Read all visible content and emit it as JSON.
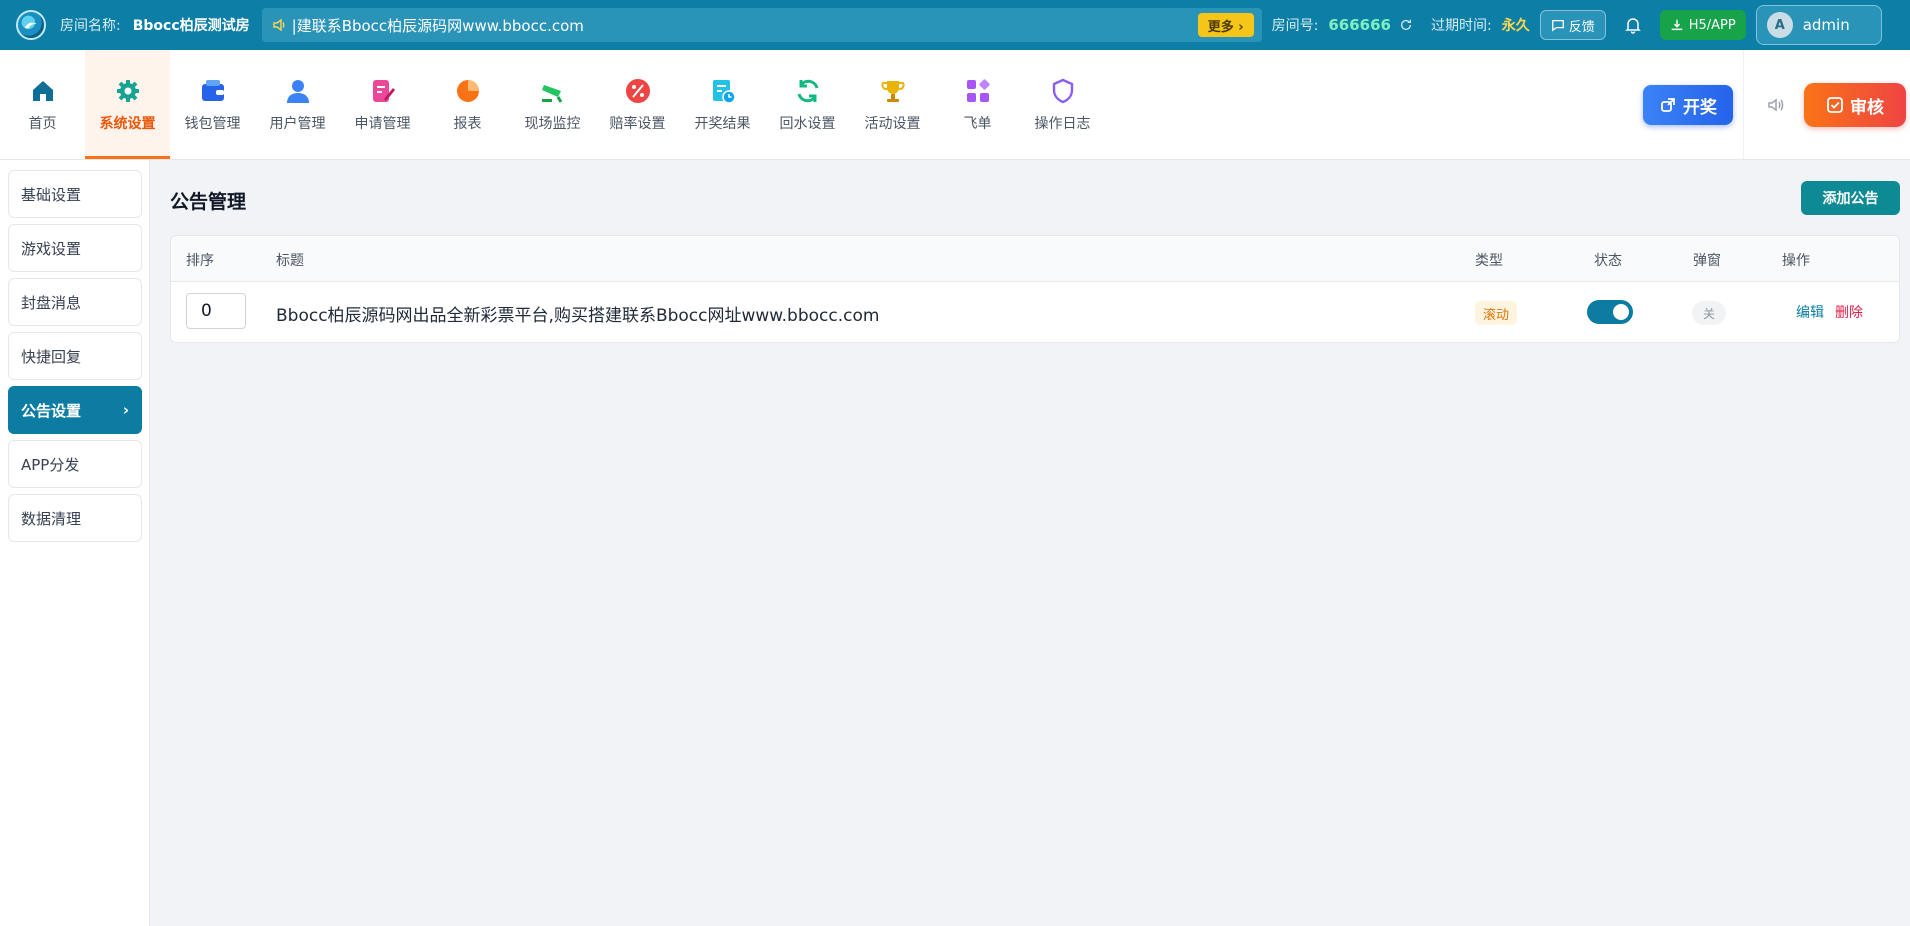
{
  "topbar": {
    "room_label": "房间名称:",
    "room_name": "Bbocc柏辰测试房",
    "marquee_text": "|建联系Bbocc柏辰源码网www.bbocc.com",
    "more_label": "更多 ›",
    "room_no_label": "房间号:",
    "room_no": "666666",
    "expire_label": "过期时间:",
    "expire_value": "永久",
    "feedback_label": "反馈",
    "h5_label": "H5/APP",
    "avatar_letter": "A",
    "user_name": "admin"
  },
  "nav": {
    "items": [
      {
        "label": "首页"
      },
      {
        "label": "系统设置"
      },
      {
        "label": "钱包管理"
      },
      {
        "label": "用户管理"
      },
      {
        "label": "申请管理"
      },
      {
        "label": "报表"
      },
      {
        "label": "现场监控"
      },
      {
        "label": "赔率设置"
      },
      {
        "label": "开奖结果"
      },
      {
        "label": "回水设置"
      },
      {
        "label": "活动设置"
      },
      {
        "label": "飞单"
      },
      {
        "label": "操作日志"
      }
    ],
    "active_index": 1,
    "draw_label": "开奖",
    "audit_label": "审核"
  },
  "sidebar": {
    "items": [
      {
        "label": "基础设置"
      },
      {
        "label": "游戏设置"
      },
      {
        "label": "封盘消息"
      },
      {
        "label": "快捷回复"
      },
      {
        "label": "公告设置",
        "arrow": "›"
      },
      {
        "label": "APP分发"
      },
      {
        "label": "数据清理"
      }
    ]
  },
  "main": {
    "title": "公告管理",
    "add_label": "添加公告",
    "columns": {
      "sort": "排序",
      "title": "标题",
      "type": "类型",
      "status": "状态",
      "popup": "弹窗",
      "ops": "操作"
    },
    "rows": [
      {
        "sort": "0",
        "title": "Bbocc柏辰源码网出品全新彩票平台,购买搭建联系Bbocc网址www.bbocc.com",
        "type": "滚动",
        "status_on": true,
        "popup": "关",
        "edit_label": "编辑",
        "delete_label": "删除"
      }
    ]
  },
  "colors": {
    "topbar": "#0d7ea6",
    "accent": "#0c7ca3",
    "active_nav": "#ea580c",
    "delete": "#e11d48"
  }
}
